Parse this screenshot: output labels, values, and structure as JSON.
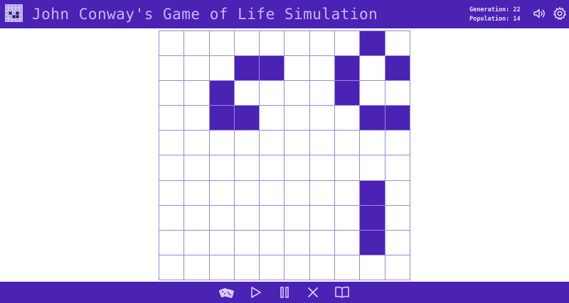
{
  "header": {
    "title": "John Conway's Game of Life Simulation",
    "generation_label": "Generation:",
    "generation_value": "22",
    "population_label": "Population:",
    "population_value": "14",
    "icons": [
      "logo-icon",
      "sound-icon",
      "settings-icon"
    ]
  },
  "board": {
    "rows": 10,
    "cols": 10,
    "alive": [
      [
        0,
        8
      ],
      [
        1,
        3
      ],
      [
        1,
        4
      ],
      [
        1,
        7
      ],
      [
        1,
        9
      ],
      [
        2,
        2
      ],
      [
        2,
        7
      ],
      [
        3,
        2
      ],
      [
        3,
        3
      ],
      [
        3,
        8
      ],
      [
        3,
        9
      ],
      [
        6,
        8
      ],
      [
        7,
        8
      ],
      [
        8,
        8
      ]
    ]
  },
  "controls": [
    "randomize-dice-icon",
    "play-icon",
    "pause-icon",
    "clear-icon",
    "rules-book-icon"
  ],
  "colors": {
    "accent": "#4a22b4",
    "grid_line": "#9b87e0",
    "title_text": "#c9b6ff"
  }
}
